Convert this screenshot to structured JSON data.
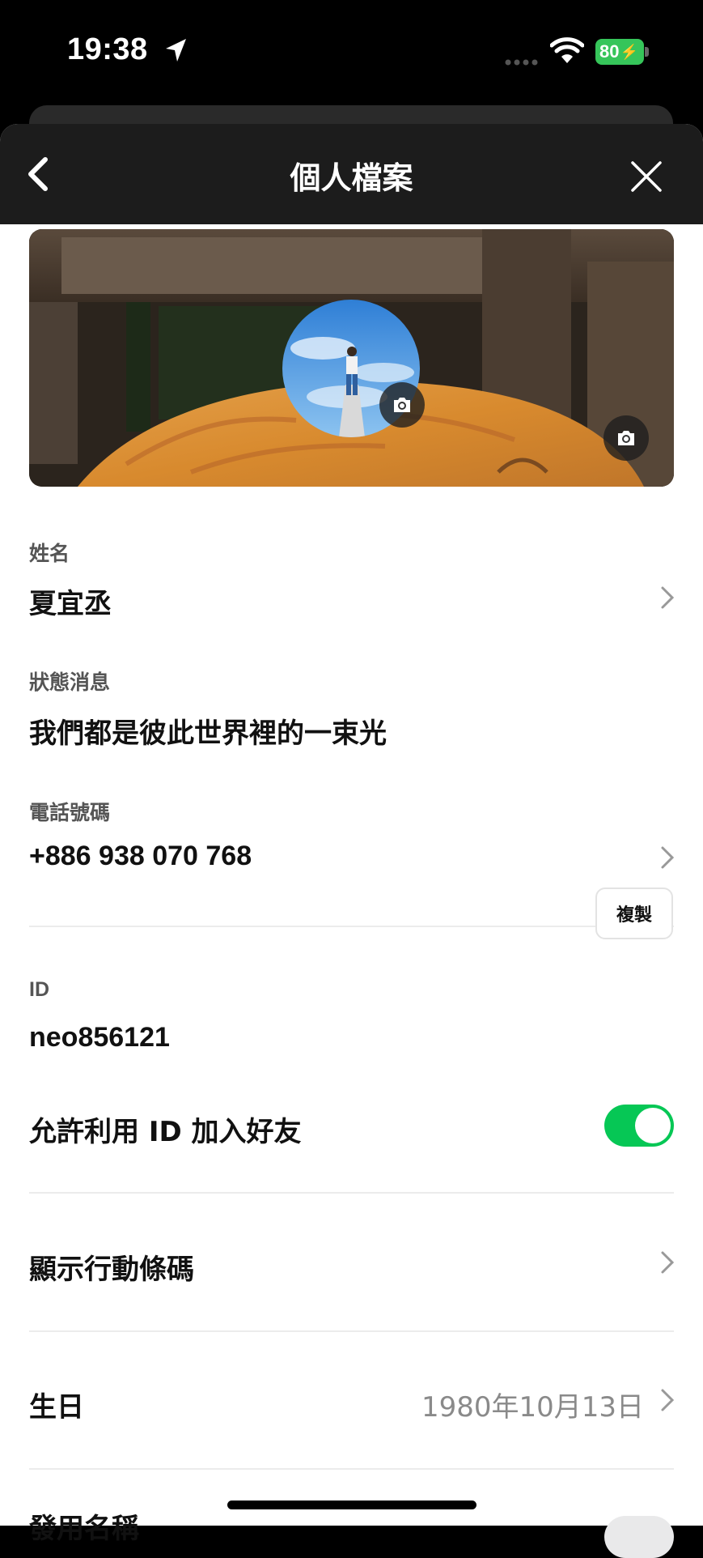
{
  "status_bar": {
    "time": "19:38",
    "battery": "80"
  },
  "nav": {
    "title": "個人檔案"
  },
  "profile": {
    "name_label": "姓名",
    "name": "夏宜丞",
    "status_label": "狀態消息",
    "status": "我們都是彼此世界裡的一束光",
    "phone_label": "電話號碼",
    "phone": "+886 938 070 768",
    "id_label": "ID",
    "id": "neo856121",
    "copy_label": "複製",
    "allow_id_label": "允許利用 ID 加入好友",
    "allow_id_enabled": true,
    "barcode_label": "顯示行動條碼",
    "birthday_label": "生日",
    "birthday": "1980年10月13日",
    "next_label": "發用名稱"
  },
  "colors": {
    "accent": "#06c755",
    "navbar": "#1c1c1c"
  },
  "icons": [
    "location-arrow-icon",
    "wifi-icon",
    "battery-icon",
    "back-chevron-icon",
    "close-icon",
    "camera-icon",
    "chevron-right-icon"
  ]
}
